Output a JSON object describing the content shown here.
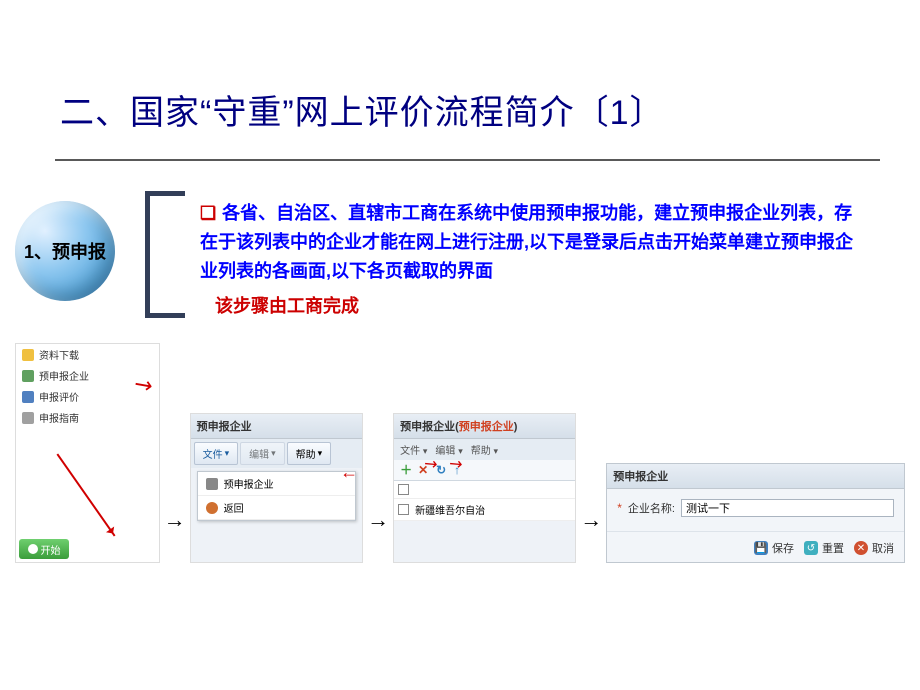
{
  "slide": {
    "title": "二、国家“守重”网上评价流程简介〔1〕",
    "sphere_label": "1、预申报",
    "description": "各省、自治区、直辖市工商在系统中使用预申报功能，建立预申报企业列表，存在于该列表中的企业才能在网上进行注册,以下是登录后点击开始菜单建立预申报企业列表的各画面,以下各页截取的界面",
    "sub_note": "该步骤由工商完成"
  },
  "shot1": {
    "items": [
      "资料下载",
      "预申报企业",
      "申报评价",
      "申报指南"
    ],
    "start_label": "开始"
  },
  "shot2": {
    "header": "预申报企业",
    "toolbar": {
      "file": "文件",
      "edit": "编辑",
      "help": "帮助"
    },
    "dropdown": {
      "item1": "预申报企业",
      "item2": "返回"
    }
  },
  "shot3": {
    "header_main": "预申报企业(",
    "header_red": "预申报企业",
    "header_close": ")",
    "toolbar": {
      "file": "文件",
      "edit": "编辑",
      "help": "帮助"
    },
    "list_item": "新疆维吾尔自治"
  },
  "shot4": {
    "header": "预申报企业",
    "field_label": "企业名称:",
    "field_value": "测试一下",
    "buttons": {
      "save": "保存",
      "reset": "重置",
      "cancel": "取消"
    }
  }
}
